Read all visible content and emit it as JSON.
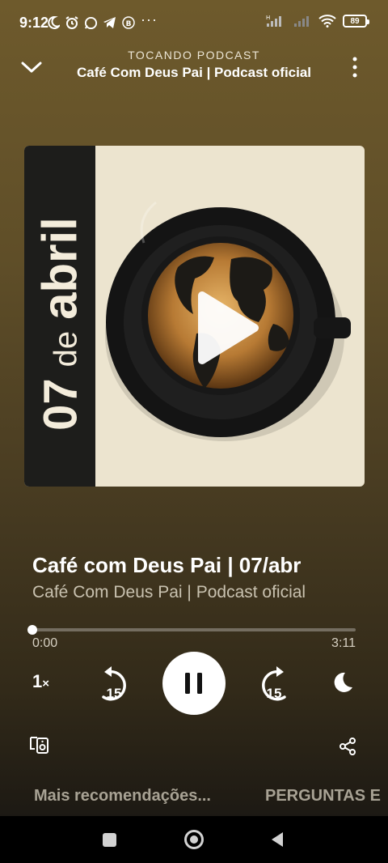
{
  "status_bar": {
    "time": "9:12",
    "more_indicator": "···",
    "battery": "89",
    "icons": [
      "moon-icon",
      "alarm-icon",
      "whatsapp-icon",
      "telegram-icon",
      "b-circle-icon",
      "signal-icon",
      "wifi-icon",
      "battery-icon"
    ]
  },
  "header": {
    "label": "TOCANDO PODCAST",
    "title": "Café Com Deus Pai | Podcast oficial"
  },
  "artwork": {
    "day": "07",
    "de": "de",
    "month": "abril",
    "colors": {
      "strip": "#1d1d1b",
      "background": "#ece4cf"
    }
  },
  "episode": {
    "title": "Café com Deus Pai | 07/abr",
    "show": "Café Com Deus Pai | Podcast oficial"
  },
  "playback": {
    "elapsed": "0:00",
    "total": "3:11",
    "progress": 0.0,
    "speed": "1",
    "speed_suffix": "×",
    "skip_back": "15",
    "skip_forward": "15",
    "state": "playing"
  },
  "tabs": [
    {
      "label": "Mais recomendações..."
    },
    {
      "label": "PERGUNTAS E"
    }
  ],
  "colors": {
    "background_top": "#6e5a2c",
    "background_bottom": "#121212",
    "accent": "#ffffff"
  }
}
